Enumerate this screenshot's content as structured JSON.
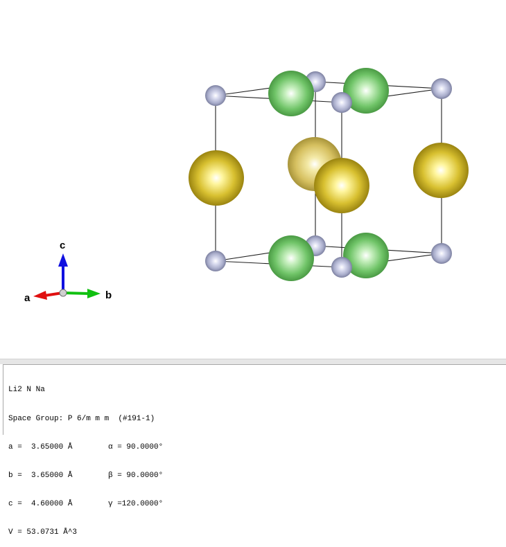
{
  "crystal_viewer": {
    "axes": {
      "a_label": "a",
      "b_label": "b",
      "c_label": "c",
      "colors": {
        "a": "#e01010",
        "b": "#10c010",
        "c": "#1010e0"
      }
    },
    "atom_colors": {
      "Li": "#b4b8d8",
      "N": "#d4c030",
      "Na": "#78cc70"
    }
  },
  "info": {
    "formula": "Li2 N Na",
    "space_group": "Space Group: P 6/m m m  (#191-1)",
    "a": "a =  3.65000 Å",
    "b": "b =  3.65000 Å",
    "c": "c =  4.60000 Å",
    "alpha": "α = 90.0000°",
    "beta": "β = 90.0000°",
    "gamma": "γ =120.0000°",
    "volume": "V = 53.0731 Å^3"
  }
}
